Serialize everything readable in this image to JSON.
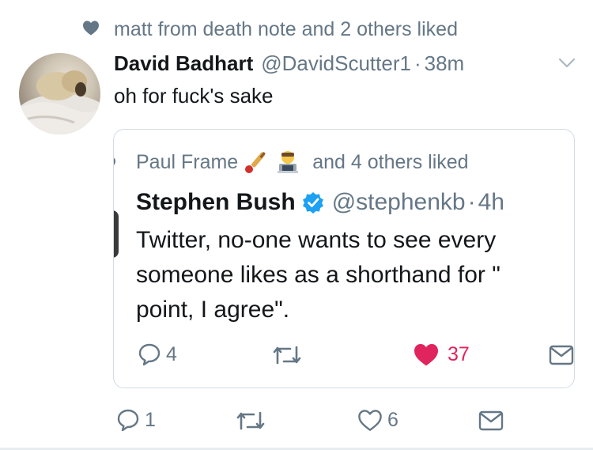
{
  "social_context": {
    "icon": "heart-icon",
    "text": "matt from death note and 2 others liked"
  },
  "tweet": {
    "author_name": "David Badhart",
    "author_handle": "@DavidScutter1",
    "separator": "·",
    "timestamp": "38m",
    "text": "oh for fuck's sake",
    "actions": {
      "reply_count": "1",
      "like_count": "6"
    }
  },
  "quoted_tweet": {
    "social_context": {
      "name": "Paul Frame",
      "emojis": [
        "cricket-emoji",
        "technologist-emoji"
      ],
      "suffix": "and 4 others liked"
    },
    "author_name": "Stephen Bush",
    "verified": true,
    "author_handle": "@stephenkb",
    "separator": "·",
    "timestamp": "4h",
    "text_lines": [
      "Twitter, no-one wants to see every",
      "someone likes as a shorthand for \"",
      "point, I agree\"."
    ],
    "actions": {
      "reply_count": "4",
      "like_count": "37",
      "liked": true
    }
  },
  "colors": {
    "text": "#14171a",
    "muted": "#657786",
    "like_red": "#e0245e",
    "verified_blue": "#1da1f2",
    "border": "#d4dbe1"
  }
}
